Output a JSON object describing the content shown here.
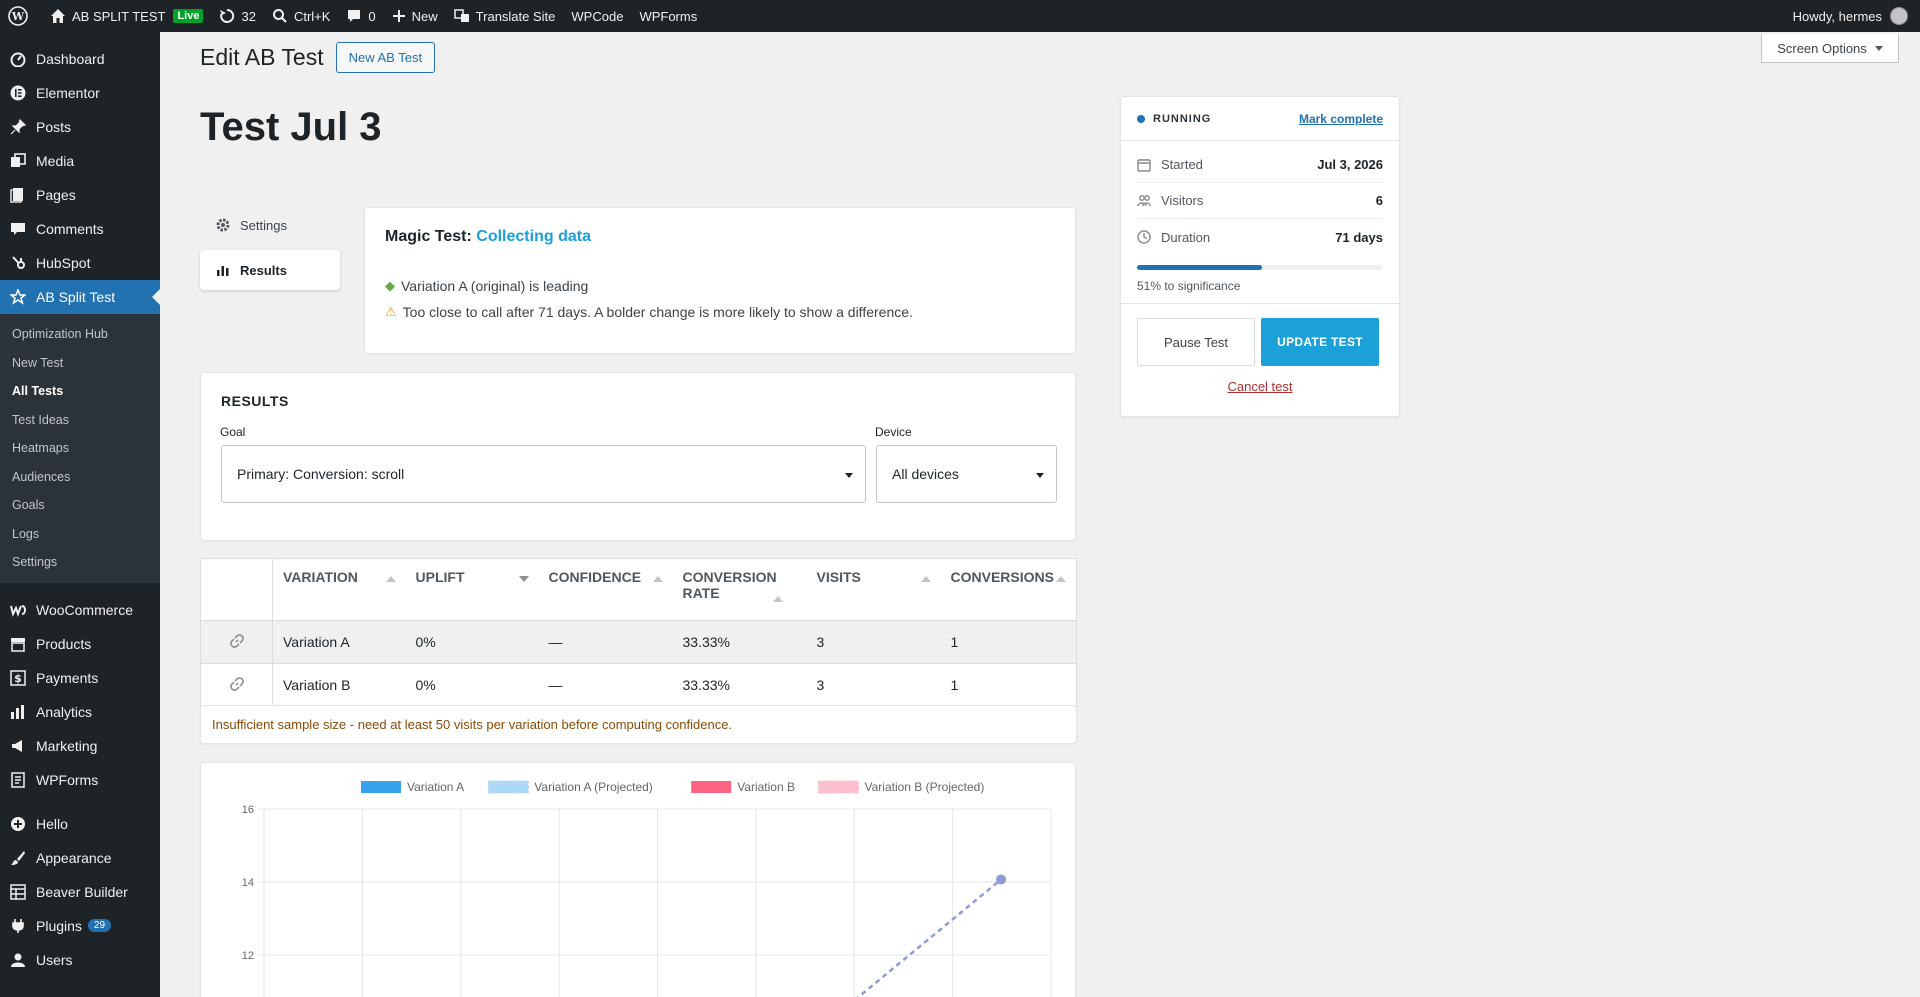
{
  "adminbar": {
    "site_name": "AB SPLIT TEST",
    "live_badge": "Live",
    "updates_count": "32",
    "search_shortcut": "Ctrl+K",
    "comments_count": "0",
    "new_label": "New",
    "translate_label": "Translate Site",
    "wpcode_label": "WPCode",
    "wpforms_label": "WPForms",
    "greeting": "Howdy, hermes"
  },
  "sidebar": {
    "items": [
      {
        "label": "Dashboard",
        "icon": "dashboard-icon"
      },
      {
        "label": "Elementor",
        "icon": "elementor-icon"
      },
      {
        "label": "Posts",
        "icon": "pin-icon"
      },
      {
        "label": "Media",
        "icon": "media-icon"
      },
      {
        "label": "Pages",
        "icon": "pages-icon"
      },
      {
        "label": "Comments",
        "icon": "comment-icon"
      },
      {
        "label": "HubSpot",
        "icon": "hubspot-icon"
      },
      {
        "label": "AB Split Test",
        "icon": "ab-test-icon"
      }
    ],
    "submenu": [
      "Optimization Hub",
      "New Test",
      "All Tests",
      "Test Ideas",
      "Heatmaps",
      "Audiences",
      "Goals",
      "Logs",
      "Settings"
    ],
    "items2": [
      {
        "label": "WooCommerce",
        "icon": "woo-icon"
      },
      {
        "label": "Products",
        "icon": "archive-icon"
      },
      {
        "label": "Payments",
        "icon": "dollar-icon"
      },
      {
        "label": "Analytics",
        "icon": "bar-chart-icon"
      },
      {
        "label": "Marketing",
        "icon": "megaphone-icon"
      },
      {
        "label": "WPForms",
        "icon": "forms-icon"
      }
    ],
    "items3": [
      {
        "label": "Hello",
        "icon": "plus-circle-icon"
      },
      {
        "label": "Appearance",
        "icon": "brush-icon"
      },
      {
        "label": "Beaver Builder",
        "icon": "grid-icon"
      },
      {
        "label": "Plugins",
        "icon": "plug-icon",
        "badge": "29"
      },
      {
        "label": "Users",
        "icon": "user-icon"
      }
    ]
  },
  "header": {
    "screen_options": "Screen Options",
    "page_title": "Edit AB Test",
    "new_button": "New AB Test",
    "test_title": "Test Jul 3"
  },
  "tabs": {
    "settings": "Settings",
    "results": "Results"
  },
  "magic": {
    "prefix": "Magic Test:",
    "status": "Collecting data",
    "line1": "Variation A (original) is leading",
    "line2": "Too close to call after 71 days. A bolder change is more likely to show a difference."
  },
  "results": {
    "title": "RESULTS",
    "goal_label": "Goal",
    "goal_value": "Primary: Conversion: scroll",
    "device_label": "Device",
    "device_value": "All devices"
  },
  "table": {
    "headers": [
      "VARIATION",
      "UPLIFT",
      "CONFIDENCE",
      "CONVERSION RATE",
      "VISITS",
      "CONVERSIONS"
    ],
    "rows": [
      [
        "Variation A",
        "0%",
        "—",
        "33.33%",
        "3",
        "1"
      ],
      [
        "Variation B",
        "0%",
        "—",
        "33.33%",
        "3",
        "1"
      ]
    ],
    "note": "Insufficient sample size - need at least 50 visits per variation before computing confidence."
  },
  "chart_data": {
    "type": "line",
    "series": [
      {
        "name": "Variation A",
        "color": "#36a2eb",
        "values": []
      },
      {
        "name": "Variation A (Projected)",
        "color": "#9ad0f5",
        "values": []
      },
      {
        "name": "Variation B",
        "color": "#ff6384",
        "values": []
      },
      {
        "name": "Variation B (Projected)",
        "color": "#ffb1c1",
        "values": []
      }
    ],
    "yticks": [
      "16",
      "14",
      "12"
    ],
    "ylim": [
      10,
      16
    ],
    "legend": "top",
    "grid": true
  },
  "status_panel": {
    "state": "RUNNING",
    "mark_complete": "Mark complete",
    "started_label": "Started",
    "started_value": "Jul 3, 2026",
    "visitors_label": "Visitors",
    "visitors_value": "6",
    "duration_label": "Duration",
    "duration_value": "71 days",
    "significance_progress": 0.51,
    "significance_text": "51% to significance",
    "pause_button": "Pause Test",
    "update_button": "UPDATE TEST",
    "cancel_link": "Cancel test"
  },
  "colors": {
    "accent": "#2271b1",
    "cta": "#1ba0d8",
    "danger": "#b32d2e",
    "warning_text": "#8a4b08"
  }
}
